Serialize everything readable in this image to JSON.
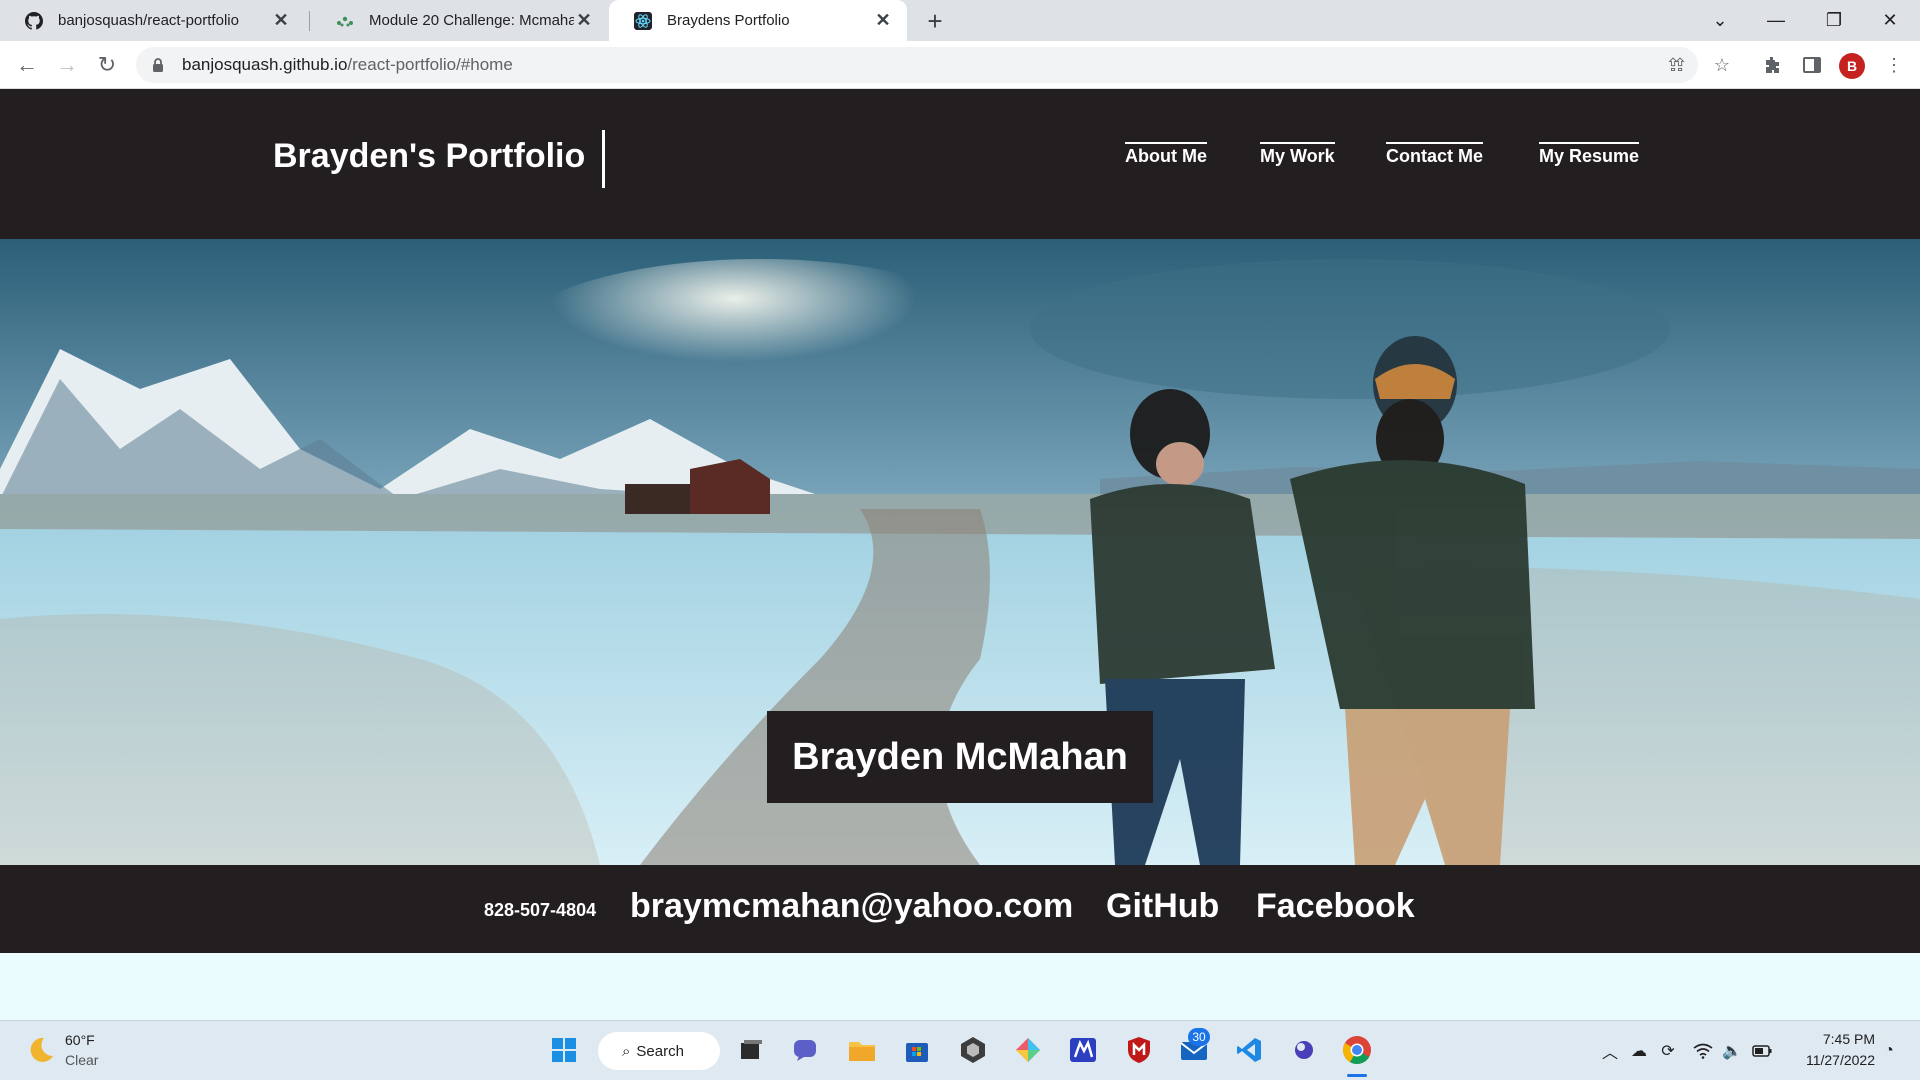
{
  "browser": {
    "tabs": [
      {
        "title": "banjosquash/react-portfolio",
        "icon": "github-icon"
      },
      {
        "title": "Module 20 Challenge: Mcmahan,",
        "icon": "canvas-icon"
      },
      {
        "title": "Braydens Portfolio",
        "icon": "react-icon",
        "active": true
      }
    ],
    "url_host": "banjosquash.github.io",
    "url_path": "/react-portfolio/#home",
    "profile_initial": "B"
  },
  "site": {
    "brand": "Brayden's Portfolio",
    "nav": [
      "About Me",
      "My Work",
      "Contact Me",
      "My Resume"
    ],
    "hero_name": "Brayden McMahan",
    "footer": {
      "phone": "828-507-4804",
      "email": "braymcmahan@yahoo.com",
      "github": "GitHub",
      "facebook": "Facebook"
    }
  },
  "taskbar": {
    "weather_temp": "60°F",
    "weather_cond": "Clear",
    "search_label": "Search",
    "mail_badge": "30",
    "time": "7:45 PM",
    "date": "11/27/2022"
  }
}
